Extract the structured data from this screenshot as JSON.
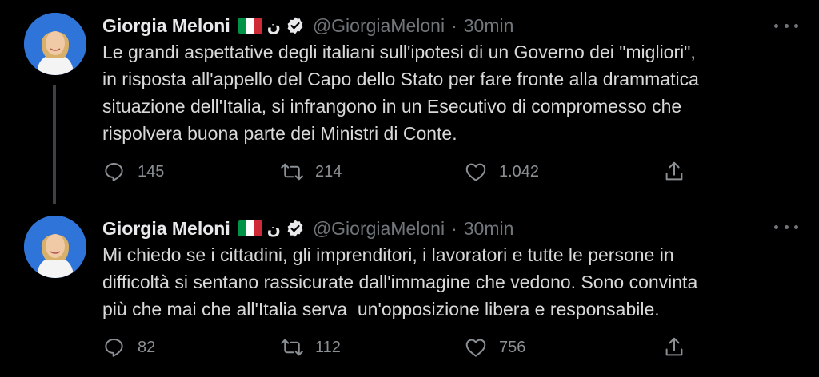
{
  "colors": {
    "background": "#000000",
    "text": "#d9d9d9",
    "muted": "#71767b",
    "verified": "#e7e9ea",
    "flag": [
      "#009246",
      "#ffffff",
      "#ce2b37"
    ]
  },
  "tweets": [
    {
      "author": {
        "name": "Giorgia Meloni",
        "emoji_suffix": "ن",
        "handle": "@GiorgiaMeloni",
        "time": "30min"
      },
      "separator": "·",
      "text_lines": [
        "Le grandi aspettative degli italiani sull'ipotesi di un Governo dei \"migliori\",",
        "in risposta all'appello del Capo dello Stato per fare fronte alla drammatica",
        "situazione dell'Italia, si infrangono in un Esecutivo di compromesso che",
        "rispolvera buona parte dei Ministri di Conte."
      ],
      "counts": {
        "replies": "145",
        "retweets": "214",
        "likes": "1.042"
      }
    },
    {
      "author": {
        "name": "Giorgia Meloni",
        "emoji_suffix": "ن",
        "handle": "@GiorgiaMeloni",
        "time": "30min"
      },
      "separator": "·",
      "text_lines": [
        "Mi chiedo se i cittadini, gli imprenditori, i lavoratori e tutte le persone in",
        "difficoltà si sentano rassicurate dall'immagine che vedono. Sono convinta",
        "più che mai che all'Italia serva  un'opposizione libera e responsabile."
      ],
      "counts": {
        "replies": "82",
        "retweets": "112",
        "likes": "756"
      }
    }
  ],
  "icons": {
    "reply": "reply-icon",
    "retweet": "retweet-icon",
    "like": "heart-icon",
    "share": "share-icon",
    "more": "more-icon",
    "verified": "verified-badge-icon",
    "flag": "italy-flag-icon"
  }
}
